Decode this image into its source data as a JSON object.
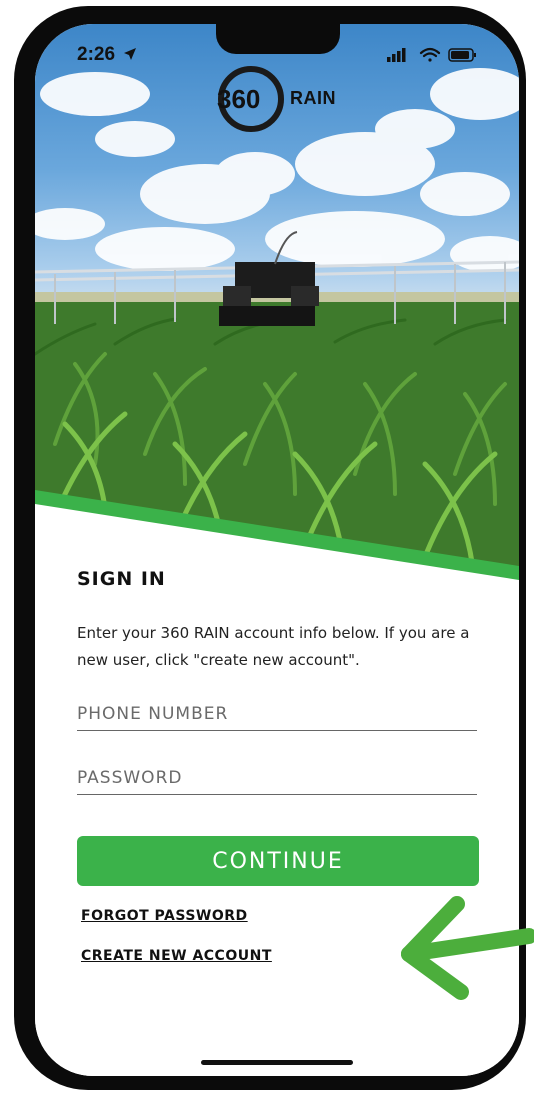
{
  "status_bar": {
    "time": "2:26"
  },
  "brand": {
    "logo_number": "360",
    "logo_text": "RAIN"
  },
  "sign_in": {
    "title": "SIGN IN",
    "description": "Enter your 360 RAIN account info below. If you are a new user, click \"create new account\".",
    "phone_placeholder": "PHONE NUMBER",
    "password_placeholder": "PASSWORD",
    "continue_label": "CONTINUE",
    "forgot_password_label": "FORGOT PASSWORD",
    "create_account_label": "CREATE NEW ACCOUNT"
  },
  "colors": {
    "accent": "#3bb24a",
    "annotation_arrow": "#4cae3c"
  },
  "icons": [
    "location-arrow-icon",
    "signal-icon",
    "wifi-icon",
    "battery-icon",
    "arrow-annotation-icon"
  ]
}
